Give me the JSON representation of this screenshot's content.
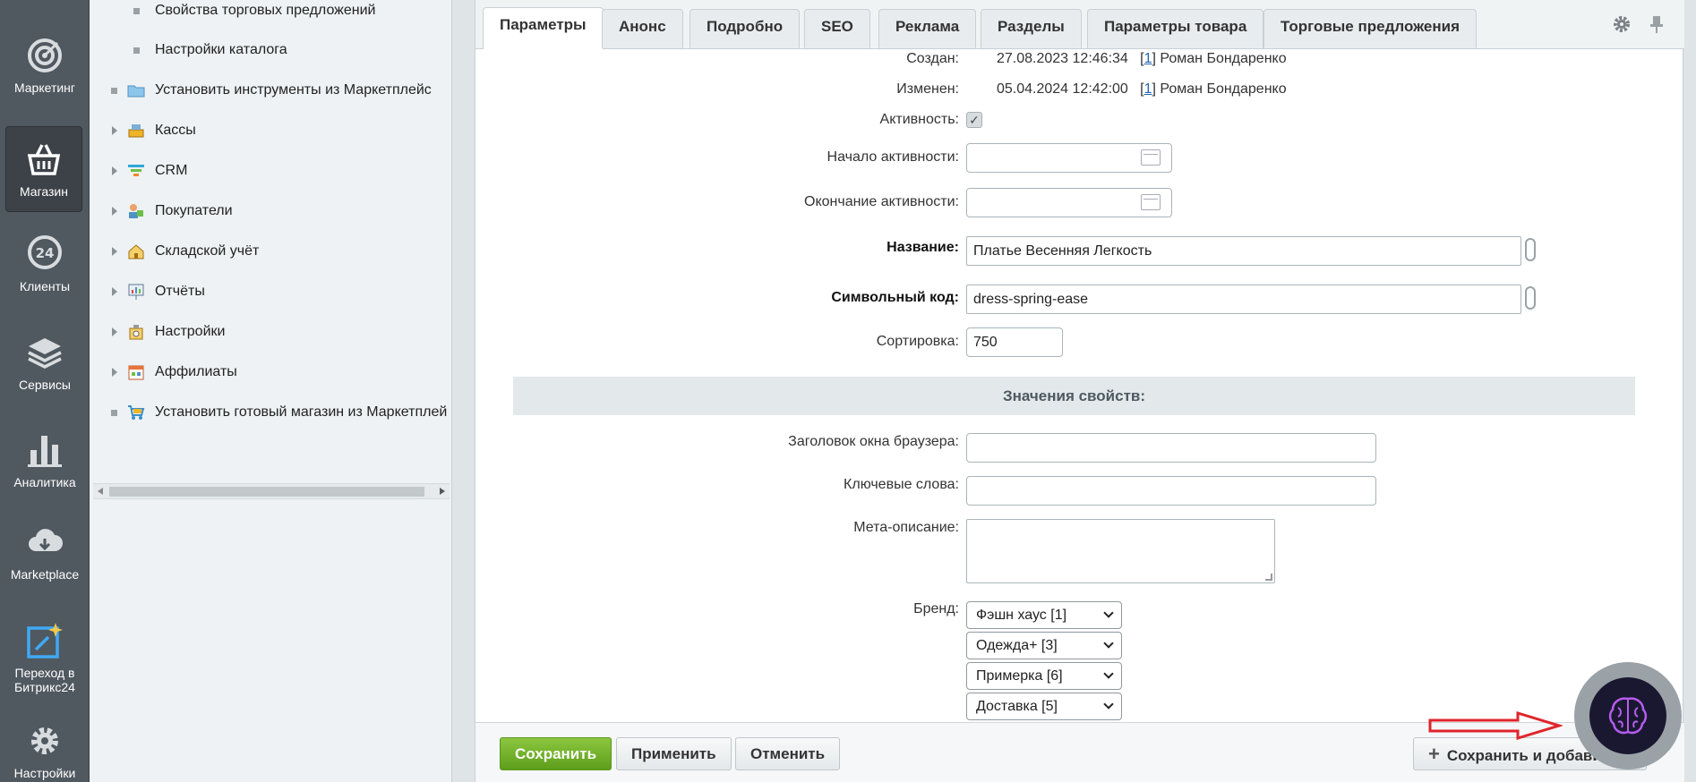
{
  "leftnav": {
    "items": [
      {
        "label": "Маркетинг",
        "icon": "target-icon"
      },
      {
        "label": "Магазин",
        "icon": "basket-icon"
      },
      {
        "label": "Клиенты",
        "icon": "clients-24-icon"
      },
      {
        "label": "Сервисы",
        "icon": "layers-icon"
      },
      {
        "label": "Аналитика",
        "icon": "bar-chart-icon"
      },
      {
        "label": "Marketplace",
        "icon": "cloud-download-icon"
      },
      {
        "label": "Переход в Битрикс24",
        "icon": "bitrix24-icon"
      },
      {
        "label": "Настройки",
        "icon": "gear-icon"
      }
    ]
  },
  "tree": {
    "items": [
      {
        "label": "Свойства торговых предложений",
        "kind": "dot"
      },
      {
        "label": "Настройки каталога",
        "kind": "dot"
      },
      {
        "label": "Установить инструменты из Маркетплейс",
        "kind": "dot-icon",
        "icon": "folder-icon"
      },
      {
        "label": "Кассы",
        "kind": "arrow",
        "icon": "cash-register-icon"
      },
      {
        "label": "CRM",
        "kind": "arrow",
        "icon": "crm-funnel-icon"
      },
      {
        "label": "Покупатели",
        "kind": "arrow",
        "icon": "customers-icon"
      },
      {
        "label": "Складской учёт",
        "kind": "arrow",
        "icon": "warehouse-icon"
      },
      {
        "label": "Отчёты",
        "kind": "arrow",
        "icon": "reports-icon"
      },
      {
        "label": "Настройки",
        "kind": "arrow",
        "icon": "settings-icon"
      },
      {
        "label": "Аффилиаты",
        "kind": "arrow",
        "icon": "affiliates-icon"
      },
      {
        "label": "Установить готовый магазин из Маркетплей",
        "kind": "dot-icon",
        "icon": "cart-icon"
      }
    ]
  },
  "tabs": [
    "Параметры",
    "Анонс",
    "Подробно",
    "SEO",
    "Реклама",
    "Разделы",
    "Параметры товара",
    "Торговые предложения"
  ],
  "form": {
    "created_label": "Создан:",
    "created_value": "27.08.2023 12:46:34",
    "created_user_id": "1",
    "created_user": "Роман Бондаренко",
    "modified_label": "Изменен:",
    "modified_value": "05.04.2024 12:42:00",
    "modified_user_id": "1",
    "modified_user": "Роман Бондаренко",
    "active_label": "Активность:",
    "active_checked": "✓",
    "active_from_label": "Начало активности:",
    "active_to_label": "Окончание активности:",
    "name_label": "Название:",
    "name_value": "Платье Весенняя Легкость",
    "code_label": "Символьный код:",
    "code_value": "dress-spring-ease",
    "sort_label": "Сортировка:",
    "sort_value": "750",
    "section_title": "Значения свойств:",
    "browser_title_label": "Заголовок окна браузера:",
    "keywords_label": "Ключевые слова:",
    "meta_desc_label": "Мета-описание:",
    "brand_label": "Бренд:",
    "brands": [
      "Фэшн хаус [1]",
      "Одежда+ [3]",
      "Примерка [6]",
      "Доставка [5]"
    ]
  },
  "footer": {
    "save": "Сохранить",
    "apply": "Применить",
    "cancel": "Отменить",
    "save_add": "Сохранить и добавить"
  },
  "colors": {
    "accent_green": "#6aab26",
    "nav_bg": "#505860",
    "annotation_red": "#e0242a"
  }
}
